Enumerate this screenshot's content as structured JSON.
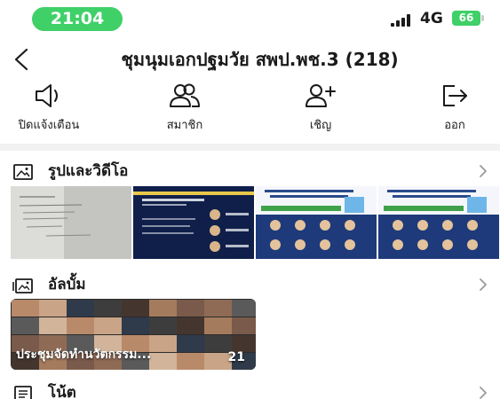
{
  "status_bar": {
    "time": "21:04",
    "network": "4G",
    "battery": "66"
  },
  "header": {
    "title": "ชุมนุมเอกปฐมวัย สพป.พช.3 (218)"
  },
  "actions": [
    {
      "label": "ปิดแจ้งเตือน",
      "icon": "speaker-mute-icon"
    },
    {
      "label": "สมาชิก",
      "icon": "members-icon"
    },
    {
      "label": "เชิญ",
      "icon": "add-person-icon"
    },
    {
      "label": "ออก",
      "icon": "exit-icon"
    }
  ],
  "sections": {
    "photos": {
      "title": "รูปและวิดีโอ",
      "icon": "image-icon"
    },
    "albums": {
      "title": "อัลบั้ม",
      "icon": "album-icon"
    },
    "notes": {
      "title": "โน้ต",
      "icon": "note-icon"
    }
  },
  "album": {
    "name": "ประชุมจัดทำนวัตกรรม...",
    "count": "21"
  },
  "colors": {
    "accent_green": "#3fd068",
    "divider": "#f2f2f2",
    "text": "#1a1a1a"
  }
}
